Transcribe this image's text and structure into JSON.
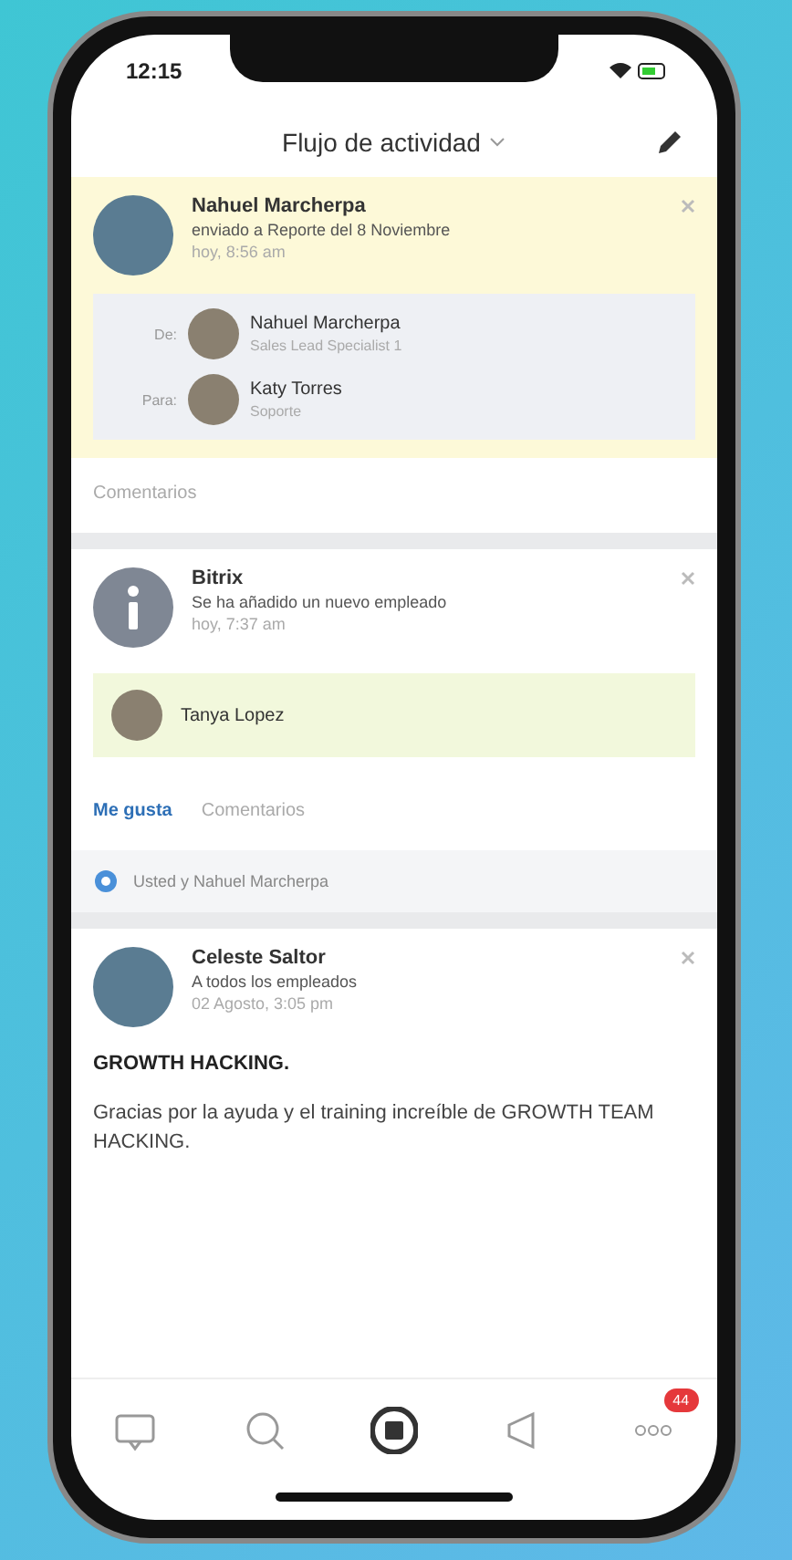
{
  "status_bar": {
    "time": "12:15"
  },
  "header": {
    "title": "Flujo de actividad"
  },
  "posts": [
    {
      "kind": "message",
      "author": "Nahuel Marcherpa",
      "subtitle": "enviado a Reporte del 8 Noviembre",
      "time": "hoy, 8:56 am",
      "highlighted": true,
      "people": [
        {
          "role": "De:",
          "name": "Nahuel Marcherpa",
          "detail": "Sales Lead Specialist 1"
        },
        {
          "role": "Para:",
          "name": "Katy Torres",
          "detail": "Soporte"
        }
      ],
      "actions": [
        {
          "label": "Comentarios",
          "selected": false
        }
      ]
    },
    {
      "kind": "notice",
      "author": "Bitrix",
      "subtitle": "Se ha añadido un nuevo empleado",
      "time": "hoy, 7:37 am",
      "highlighted": false,
      "employee": "Tanya Lopez",
      "actions": [
        {
          "label": "Me gusta",
          "selected": true
        },
        {
          "label": "Comentarios",
          "selected": false
        }
      ],
      "likes": "Usted y Nahuel Marcherpa"
    },
    {
      "kind": "post",
      "author": "Celeste Saltor",
      "subtitle": "A todos los empleados",
      "time": "02 Agosto, 3:05 pm",
      "highlighted": false,
      "heading": "GROWTH HACKING.",
      "body": "Gracias por la ayuda y el training increíble de GROWTH TEAM HACKING."
    }
  ],
  "nav": [
    {
      "kind": "chat",
      "selected": false
    },
    {
      "kind": "search",
      "selected": false
    },
    {
      "kind": "feed",
      "selected": true
    },
    {
      "kind": "megaphone",
      "selected": false
    },
    {
      "kind": "more",
      "selected": false,
      "badge": "44"
    }
  ]
}
